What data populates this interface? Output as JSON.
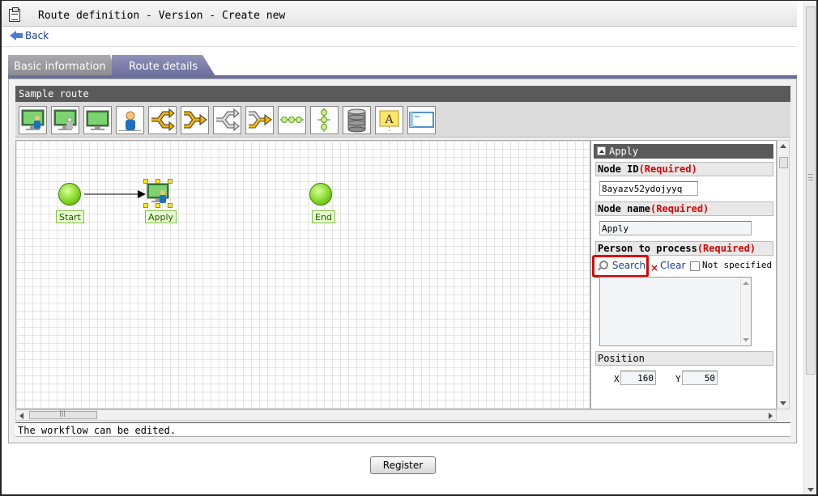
{
  "window": {
    "title": "Route definition - Version - Create new"
  },
  "nav": {
    "back_label": "Back"
  },
  "tabs": [
    {
      "label": "Basic information"
    },
    {
      "label": "Route details"
    }
  ],
  "route": {
    "name": "Sample route"
  },
  "toolbar": {
    "tools": [
      "screen-node-icon",
      "screen-user-node-icon",
      "screen-plain-node-icon",
      "user-node-icon",
      "branch-start-icon",
      "branch-end-icon",
      "parallel-start-icon",
      "parallel-end-icon",
      "horizontal-link-icon",
      "vertical-link-icon",
      "database-icon",
      "annotation-icon",
      "window-icon"
    ]
  },
  "canvas": {
    "nodes": [
      {
        "label": "Start",
        "type": "start"
      },
      {
        "label": "Apply",
        "type": "apply"
      },
      {
        "label": "End",
        "type": "end"
      }
    ]
  },
  "properties": {
    "title": "Apply",
    "node_id": {
      "label": "Node ID",
      "required": "(Required)",
      "value": "8ayazv52ydojyyq"
    },
    "node_name": {
      "label": "Node name",
      "required": "(Required)",
      "value": "Apply"
    },
    "person": {
      "label": "Person to process",
      "required": "(Required)",
      "search_label": "Search",
      "clear_label": "Clear",
      "not_specified_label": "Not specified"
    },
    "position": {
      "label": "Position",
      "x_label": "X",
      "x_value": "160",
      "y_label": "Y",
      "y_value": "50"
    }
  },
  "status": {
    "message": "The workflow can be edited."
  },
  "actions": {
    "register_label": "Register"
  },
  "colors": {
    "tab_active": "#6b6f9c",
    "required": "#e00000",
    "highlight": "#e00000",
    "node_green": "#7ed21e"
  }
}
